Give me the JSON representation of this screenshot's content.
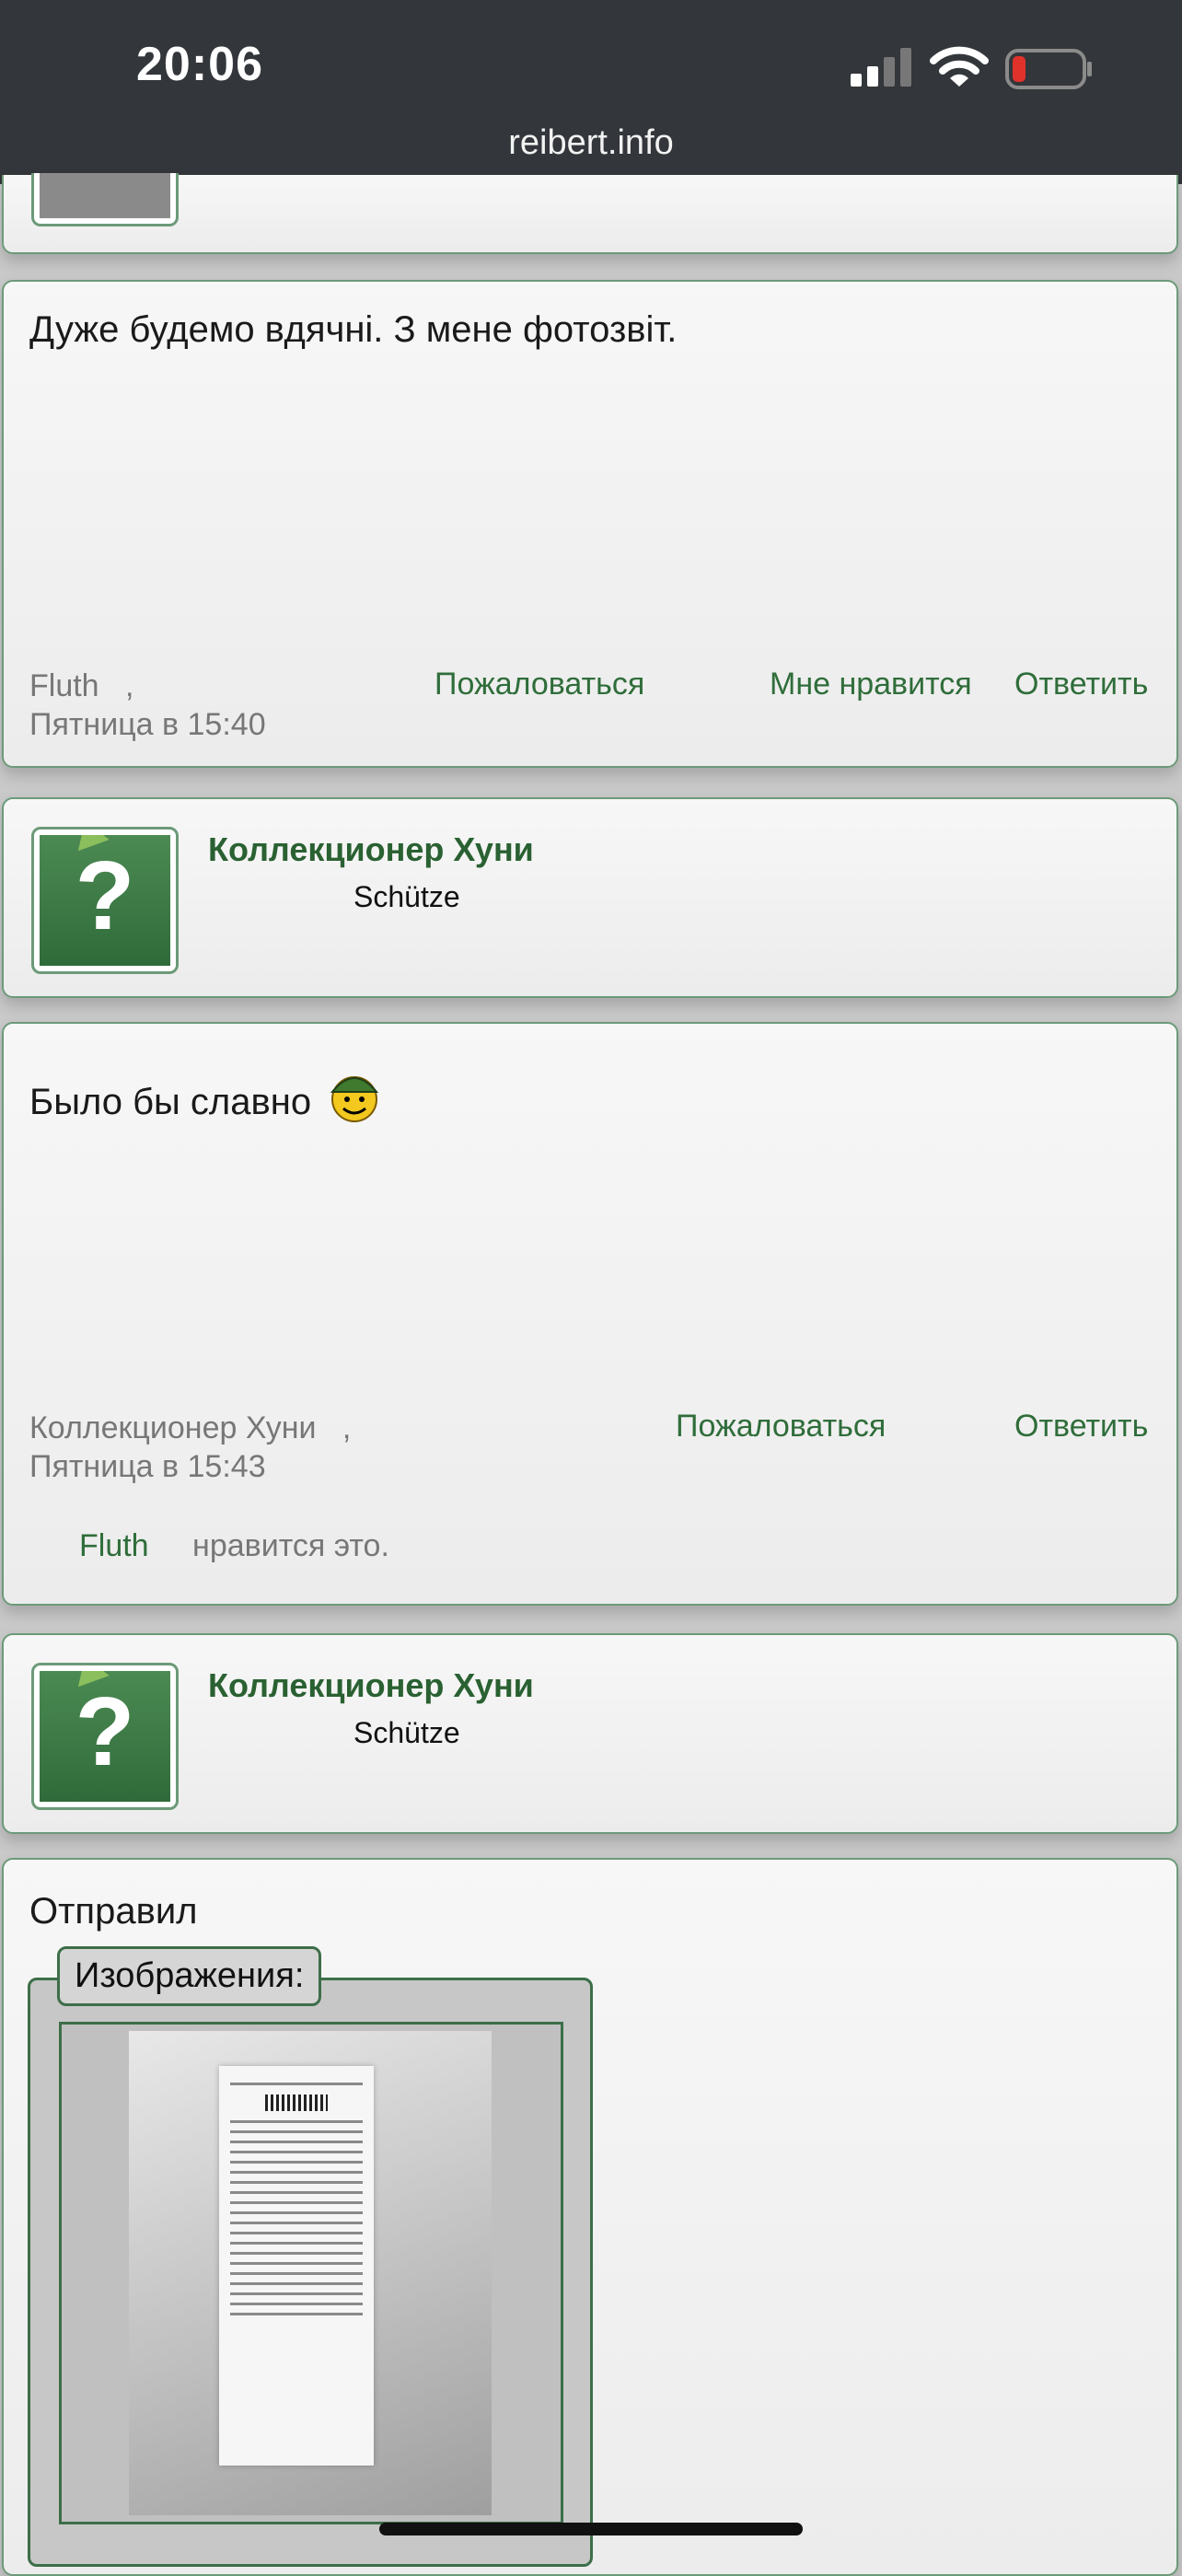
{
  "status_bar": {
    "time": "20:06",
    "url": "reibert.info",
    "battery_color": "#e0312b"
  },
  "posts": [
    {
      "message": "Дуже будемо вдячні. З мене фотозвіт.",
      "author": "Fluth",
      "sep": ",",
      "date": "Пятница в 15:40",
      "actions": {
        "report": "Пожаловаться",
        "like": "Мне нравится",
        "reply": "Ответить"
      }
    },
    {
      "user": {
        "name": "Коллекционер Хуни",
        "rank": "Schütze"
      },
      "message": "Было бы славно",
      "author": "Коллекционер Хуни",
      "sep": ",",
      "date": "Пятница в 15:43",
      "actions": {
        "report": "Пожаловаться",
        "reply": "Ответить"
      },
      "likes": {
        "user": "Fluth",
        "text": "нравится это."
      }
    },
    {
      "user": {
        "name": "Коллекционер Хуни",
        "rank": "Schütze"
      },
      "message": "Отправил",
      "attachments_label": "Изображения:"
    }
  ],
  "avatar_placeholder": "?",
  "brand_green": "#2f6d3a"
}
